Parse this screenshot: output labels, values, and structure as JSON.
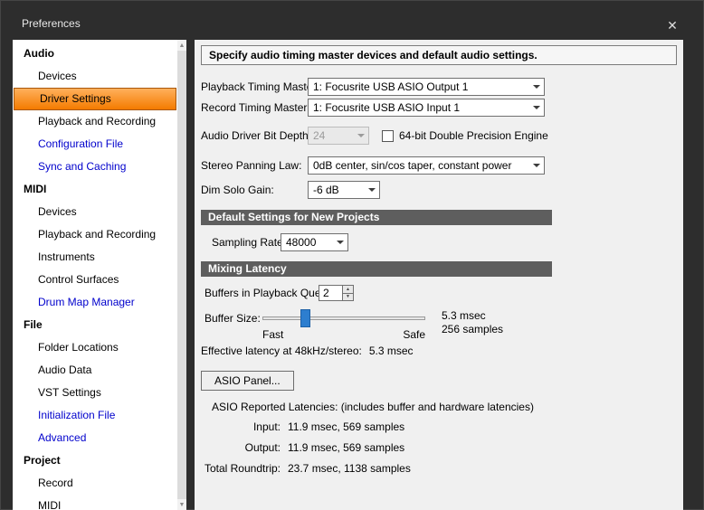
{
  "window": {
    "title": "Preferences",
    "close_glyph": "✕"
  },
  "sidebar": {
    "accent_color": "#0000cc",
    "selected_color": "#f47b00",
    "items": [
      {
        "label": "Audio",
        "type": "section"
      },
      {
        "label": "Devices",
        "type": "item"
      },
      {
        "label": "Driver Settings",
        "type": "item",
        "selected": true
      },
      {
        "label": "Playback and Recording",
        "type": "item"
      },
      {
        "label": "Configuration File",
        "type": "item",
        "accent": true
      },
      {
        "label": "Sync and Caching",
        "type": "item",
        "accent": true
      },
      {
        "label": "MIDI",
        "type": "section"
      },
      {
        "label": "Devices",
        "type": "item"
      },
      {
        "label": "Playback and Recording",
        "type": "item"
      },
      {
        "label": "Instruments",
        "type": "item"
      },
      {
        "label": "Control Surfaces",
        "type": "item"
      },
      {
        "label": "Drum Map Manager",
        "type": "item",
        "accent": true
      },
      {
        "label": "File",
        "type": "section"
      },
      {
        "label": "Folder Locations",
        "type": "item"
      },
      {
        "label": "Audio Data",
        "type": "item"
      },
      {
        "label": "VST Settings",
        "type": "item"
      },
      {
        "label": "Initialization File",
        "type": "item",
        "accent": true
      },
      {
        "label": "Advanced",
        "type": "item",
        "accent": true
      },
      {
        "label": "Project",
        "type": "section"
      },
      {
        "label": "Record",
        "type": "item"
      },
      {
        "label": "MIDI",
        "type": "item"
      }
    ]
  },
  "main": {
    "description": "Specify audio timing master devices and default audio settings.",
    "fields": {
      "playback_timing_master": {
        "label": "Playback Timing Master:",
        "value": "1: Focusrite USB ASIO Output 1"
      },
      "record_timing_master": {
        "label": "Record Timing Master:",
        "value": "1: Focusrite USB ASIO Input 1"
      },
      "audio_driver_bit_depth": {
        "label": "Audio Driver Bit Depth:",
        "value": "24",
        "disabled": true
      },
      "double_precision": {
        "label": "64-bit Double Precision Engine",
        "checked": false
      },
      "stereo_panning_law": {
        "label": "Stereo Panning Law:",
        "value": "0dB center, sin/cos taper, constant power"
      },
      "dim_solo_gain": {
        "label": "Dim Solo Gain:",
        "value": "-6 dB"
      }
    },
    "sections": {
      "new_projects_title": "Default Settings for New Projects",
      "mixing_latency_title": "Mixing Latency"
    },
    "sampling_rate": {
      "label": "Sampling Rate:",
      "value": "48000"
    },
    "buffers_queue": {
      "label": "Buffers in Playback Queue:",
      "value": "2"
    },
    "buffer_size": {
      "label": "Buffer Size:",
      "min_label": "Fast",
      "max_label": "Safe",
      "value_msec": "5.3 msec",
      "value_samples": "256 samples",
      "thumb_pos_pct": 26
    },
    "effective_latency": {
      "label": "Effective latency at 48kHz/stereo:",
      "value": "5.3 msec"
    },
    "asio_panel_button": "ASIO Panel...",
    "asio_latencies": {
      "heading": "ASIO Reported Latencies: (includes buffer and hardware latencies)",
      "rows": [
        {
          "label": "Input:",
          "value": "11.9 msec, 569 samples"
        },
        {
          "label": "Output:",
          "value": "11.9 msec, 569 samples"
        },
        {
          "label": "Total Roundtrip:",
          "value": "23.7 msec, 1138 samples"
        }
      ]
    }
  }
}
